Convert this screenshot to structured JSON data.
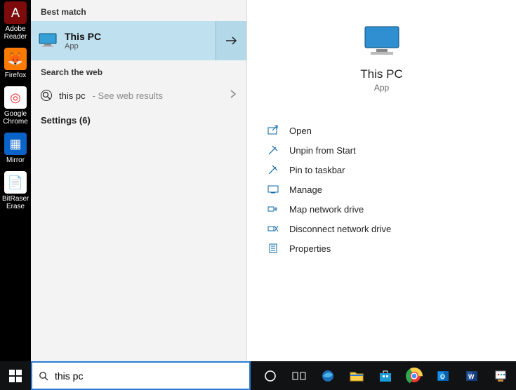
{
  "desktop_icons": [
    {
      "name": "adobe-reader",
      "label": "Adobe Reader",
      "bg": "#7d0b0b",
      "glyph": "A",
      "fg": "#fff"
    },
    {
      "name": "firefox",
      "label": "Firefox",
      "bg": "#ff7b00",
      "glyph": "🦊",
      "fg": "#fff"
    },
    {
      "name": "google-chrome",
      "label": "Google Chrome",
      "bg": "#fff",
      "glyph": "◎",
      "fg": "#e33"
    },
    {
      "name": "mirror",
      "label": "Mirror",
      "bg": "#0a63c9",
      "glyph": "▦",
      "fg": "#fff"
    },
    {
      "name": "bitraser",
      "label": "BitRaser Erase",
      "bg": "#fff",
      "glyph": "📄",
      "fg": "#000"
    }
  ],
  "search": {
    "best_match_heading": "Best match",
    "best_match": {
      "title": "This PC",
      "subtitle": "App"
    },
    "web_heading": "Search the web",
    "web_query": "this pc",
    "web_hint": "- See web results",
    "settings_label": "Settings (6)"
  },
  "preview": {
    "title": "This PC",
    "subtitle": "App",
    "actions": [
      {
        "name": "open",
        "label": "Open",
        "icon": "open"
      },
      {
        "name": "unpin-start",
        "label": "Unpin from Start",
        "icon": "unpin"
      },
      {
        "name": "pin-taskbar",
        "label": "Pin to taskbar",
        "icon": "pin"
      },
      {
        "name": "manage",
        "label": "Manage",
        "icon": "manage"
      },
      {
        "name": "map-network-drive",
        "label": "Map network drive",
        "icon": "map"
      },
      {
        "name": "disconnect-network",
        "label": "Disconnect network drive",
        "icon": "disconnect"
      },
      {
        "name": "properties",
        "label": "Properties",
        "icon": "props"
      }
    ]
  },
  "taskbar": {
    "search_value": "this pc",
    "icons": [
      {
        "name": "cortana",
        "label": "Cortana"
      },
      {
        "name": "task-view",
        "label": "Task View"
      },
      {
        "name": "edge",
        "label": "Microsoft Edge"
      },
      {
        "name": "explorer",
        "label": "File Explorer"
      },
      {
        "name": "store",
        "label": "Microsoft Store"
      },
      {
        "name": "chrome",
        "label": "Google Chrome"
      },
      {
        "name": "outlook",
        "label": "Outlook"
      },
      {
        "name": "word",
        "label": "Word"
      },
      {
        "name": "paint",
        "label": "Paint"
      }
    ]
  }
}
